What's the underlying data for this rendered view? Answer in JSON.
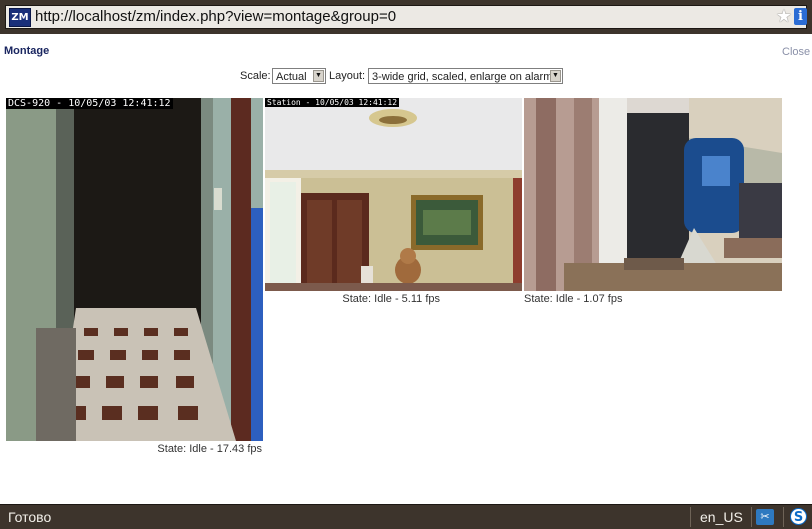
{
  "browser": {
    "url": "http://localhost/zm/index.php?view=montage&group=0",
    "app_icon": "ZM",
    "bookmark_icon": "star-icon",
    "info_icon": "info-icon"
  },
  "page": {
    "title": "Montage",
    "close_label": "Close"
  },
  "controls": {
    "scale_label": "Scale:",
    "scale_value": "Actual",
    "layout_label": "Layout:",
    "layout_value": "3-wide grid, scaled, enlarge on alarm"
  },
  "monitors": [
    {
      "osd": "DCS-920 - 10/05/03 12:41:12",
      "state": "State: Idle - 17.43 fps"
    },
    {
      "osd": "Station - 10/05/03 12:41:12",
      "state": "State: Idle - 5.11 fps"
    },
    {
      "osd": "",
      "state": "State: Idle - 1.07 fps"
    }
  ],
  "statusbar": {
    "text": "Готово",
    "lang": "en_US"
  }
}
